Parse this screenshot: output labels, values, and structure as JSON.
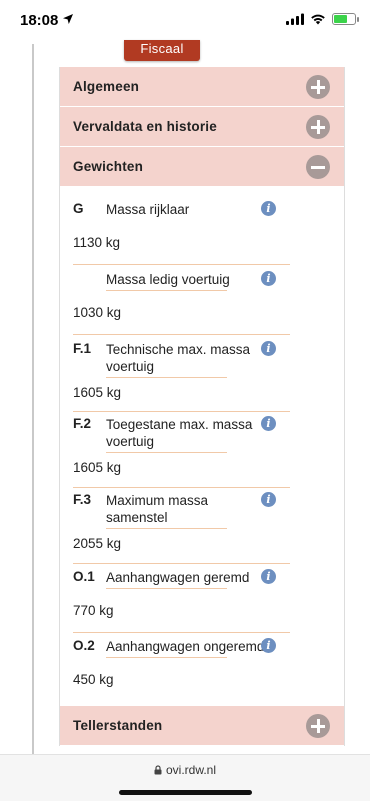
{
  "status": {
    "time": "18:08"
  },
  "top_tab": {
    "label": "Fiscaal"
  },
  "accordion": {
    "sections": [
      {
        "label": "Algemeen",
        "state": "collapsed"
      },
      {
        "label": "Vervaldata en historie",
        "state": "collapsed"
      },
      {
        "label": "Gewichten",
        "state": "expanded"
      },
      {
        "label": "Tellerstanden",
        "state": "collapsed"
      }
    ]
  },
  "weights": [
    {
      "code": "G",
      "label": "Massa rijklaar",
      "value": "1130 kg"
    },
    {
      "code": "",
      "label": "Massa ledig voertuig",
      "value": "1030 kg"
    },
    {
      "code": "F.1",
      "label": "Technische max. massa voertuig",
      "value": "1605 kg"
    },
    {
      "code": "F.2",
      "label": "Toegestane max. massa voertuig",
      "value": "1605 kg"
    },
    {
      "code": "F.3",
      "label": "Maximum massa samenstel",
      "value": "2055 kg"
    },
    {
      "code": "O.1",
      "label": "Aanhangwagen geremd",
      "value": "770 kg"
    },
    {
      "code": "O.2",
      "label": "Aanhangwagen ongeremd",
      "value": "450 kg"
    }
  ],
  "info_glyph": "i",
  "browser": {
    "url": "ovi.rdw.nl"
  },
  "icons": {
    "location": "location-arrow-icon",
    "signal": "cellular-signal-icon",
    "wifi": "wifi-icon",
    "battery": "battery-charging-icon",
    "lock": "lock-icon",
    "expand": "plus-circle-icon",
    "collapse": "minus-circle-icon",
    "info": "info-icon"
  },
  "colors": {
    "header_bg": "#f4d3cd",
    "toggle_bg": "#a89a98",
    "tab_bg": "#b13a22",
    "info_bg": "#6d8fc0",
    "separator": "#f1c9a8"
  }
}
